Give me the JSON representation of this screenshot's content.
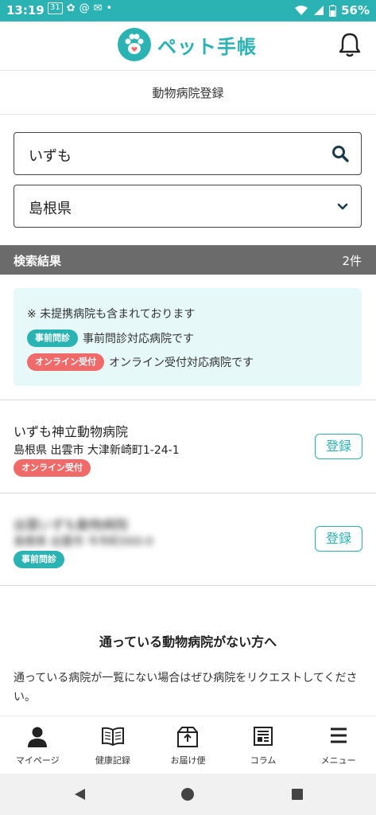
{
  "status": {
    "time": "13:19",
    "battery": "56%",
    "notif_icons": [
      "31",
      "✿",
      "@",
      "✉",
      "•"
    ]
  },
  "header": {
    "app_name": "ペット手帳"
  },
  "page": {
    "title": "動物病院登録"
  },
  "search": {
    "value": "いずも",
    "prefecture": "島根県"
  },
  "results": {
    "label": "検索結果",
    "count": "2件"
  },
  "notice": {
    "line1": "※ 未提携病院も含まれております",
    "badge_teal": "事前問診",
    "line2": "事前問診対応病院です",
    "badge_red": "オンライン受付",
    "line3": "オンライン受付対応病院です"
  },
  "hospitals": [
    {
      "name": "いずも神立動物病院",
      "address": "島根県 出雲市 大津新崎町1-24-1",
      "tag": "オンライン受付",
      "button": "登録"
    },
    {
      "name": "出雲いずも動物病院",
      "address": "島根県 出雲市 今市町000-0",
      "tag": "事前問診",
      "button": "登録"
    }
  ],
  "no_hospital": {
    "title": "通っている動物病院がない方へ",
    "desc": "通っている病院が一覧にない場合はぜひ病院をリクエストしてください。"
  },
  "nav": [
    {
      "label": "マイページ",
      "icon": "person-icon"
    },
    {
      "label": "健康記録",
      "icon": "book-icon"
    },
    {
      "label": "お届け便",
      "icon": "box-icon"
    },
    {
      "label": "コラム",
      "icon": "news-icon"
    },
    {
      "label": "メニュー",
      "icon": "menu-icon"
    }
  ],
  "colors": {
    "accent": "#2bb3b3",
    "badge_red": "#f06a6a",
    "results_bar": "#6b6b6b",
    "notice_bg": "#e6f8f8"
  }
}
